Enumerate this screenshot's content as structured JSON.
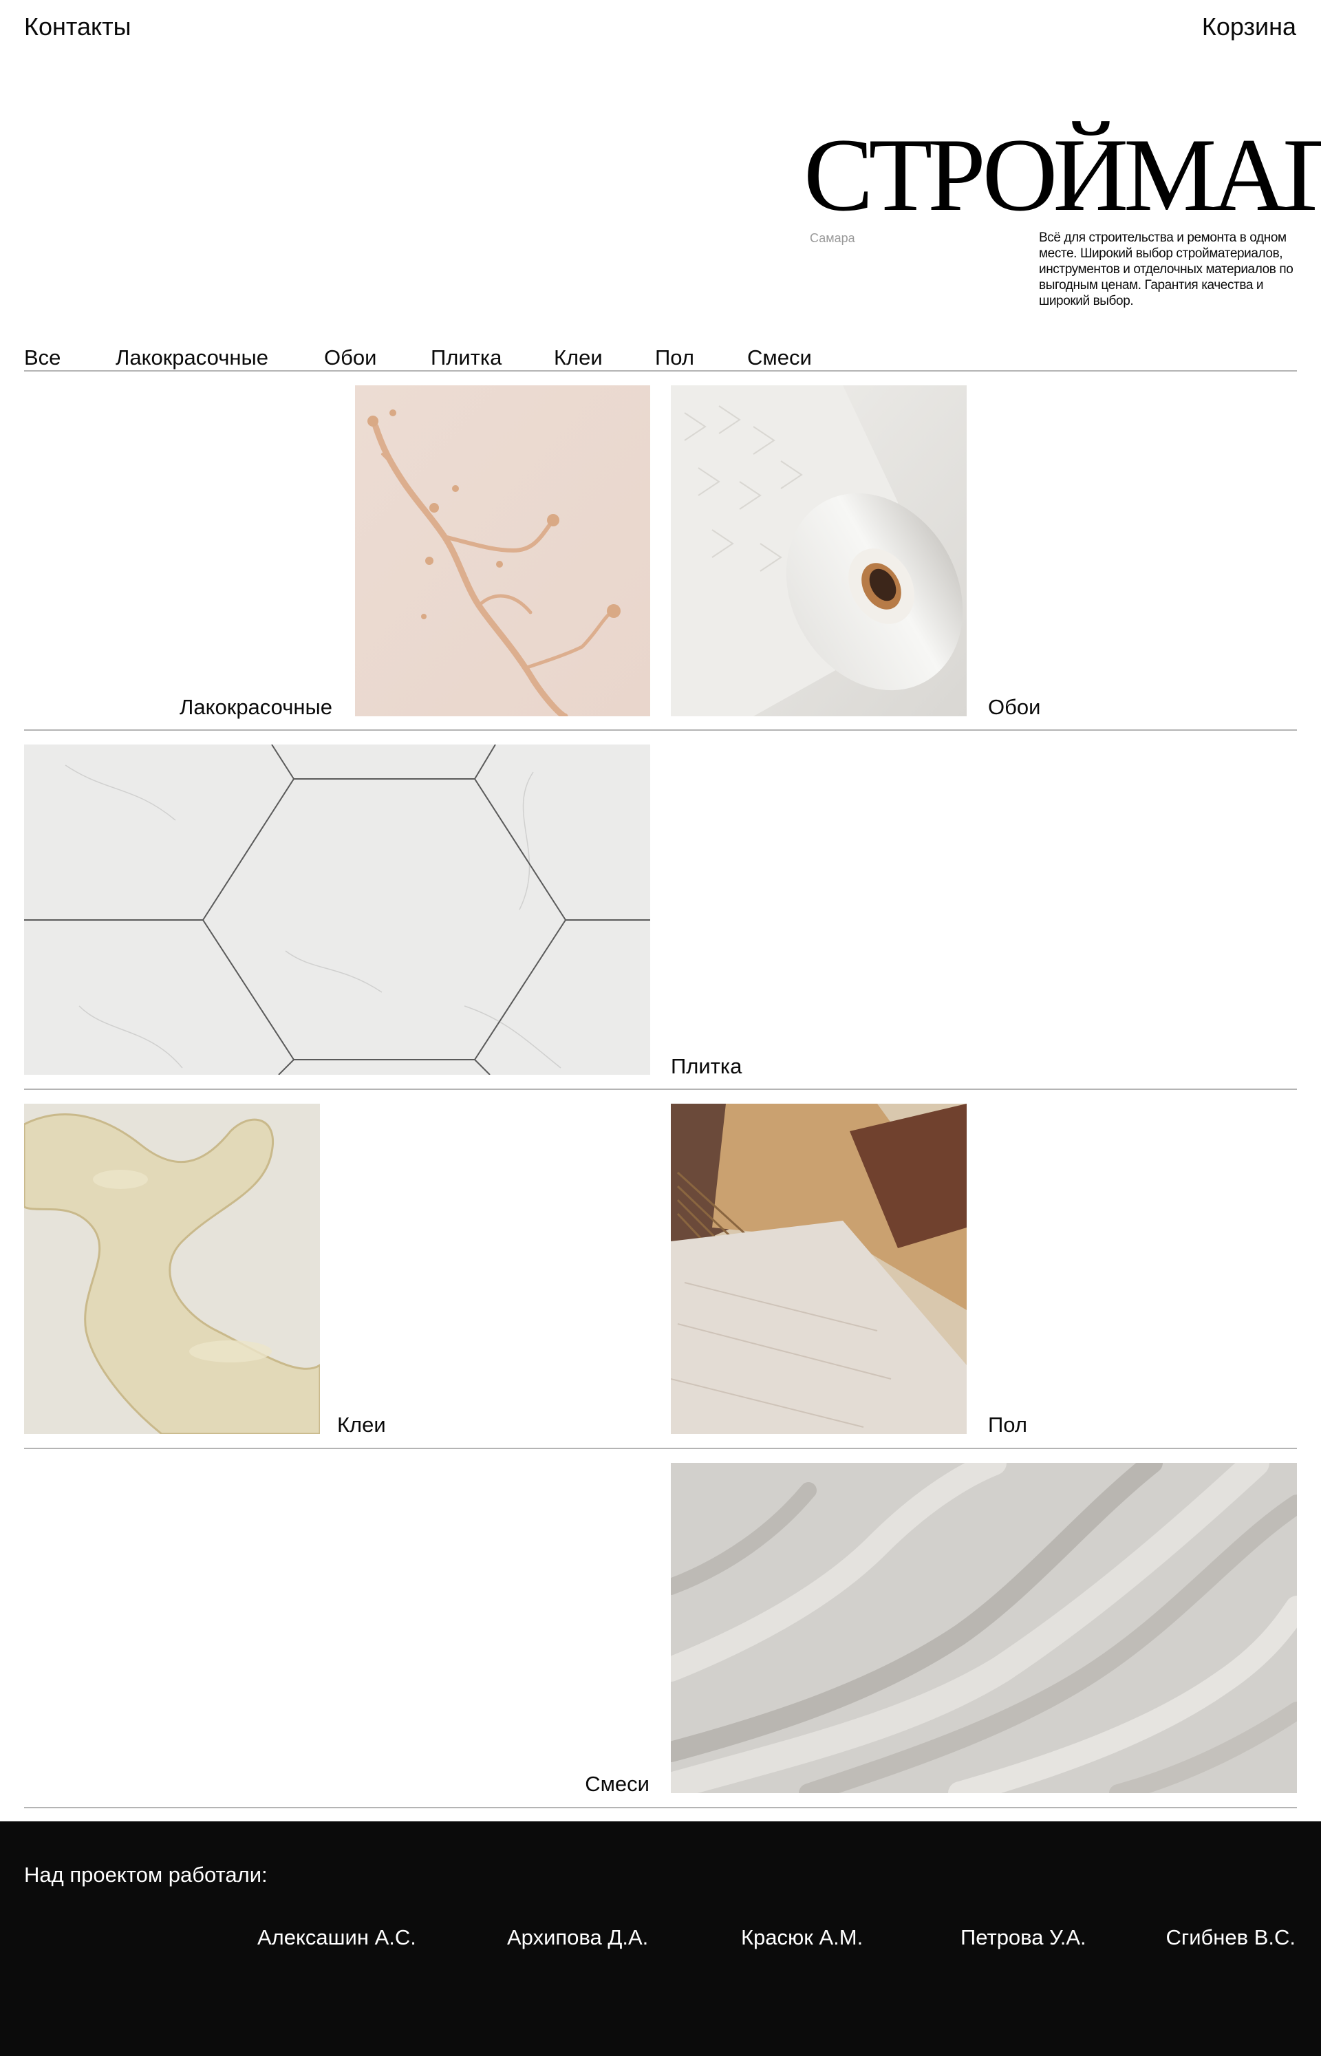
{
  "header": {
    "contacts": "Контакты",
    "cart": "Корзина"
  },
  "hero": {
    "brand": "СТРОЙМАГ.",
    "city": "Самара",
    "tagline": "Всё для строительства и ремонта в одном месте. Широкий выбор стройматериалов, инструментов и отделочных материалов по выгодным ценам. Гарантия качества и широкий выбор."
  },
  "filters": [
    "Все",
    "Лакокрасочные",
    "Обои",
    "Плитка",
    "Клеи",
    "Пол",
    "Смеси"
  ],
  "categories": [
    {
      "label": "Лакокрасочные",
      "image": "paint-splash-image"
    },
    {
      "label": "Обои",
      "image": "wallpaper-roll-image"
    },
    {
      "label": "Плитка",
      "image": "hexagon-tile-image"
    },
    {
      "label": "Клеи",
      "image": "glue-texture-image"
    },
    {
      "label": "Пол",
      "image": "floor-samples-image"
    },
    {
      "label": "Смеси",
      "image": "plaster-texture-image"
    }
  ],
  "footer": {
    "title": "Над проектом работали:",
    "authors": [
      "Алексашин А.С.",
      "Архипова Д.А.",
      "Красюк А.М.",
      "Петрова У.А.",
      "Сгибнев В.С."
    ]
  }
}
